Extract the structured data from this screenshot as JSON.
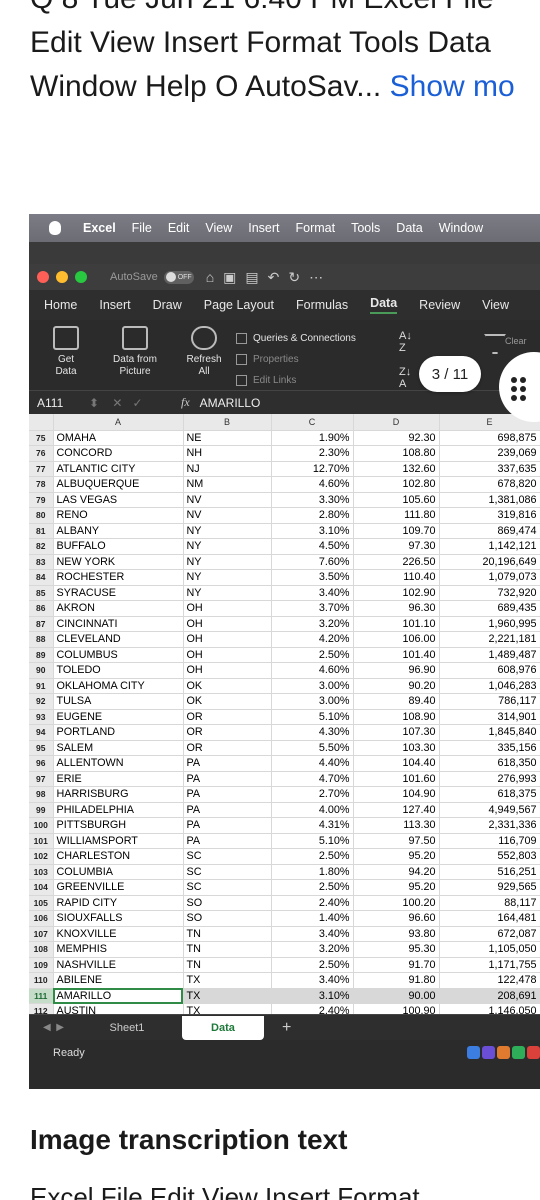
{
  "post": {
    "top_cut_text": "Q 8 Tue Jun 21 6:40 PM Excel File",
    "line1": "Edit View Insert Format Tools Data",
    "line2": "Window Help O AutoSav...",
    "show_more": "Show mo",
    "heading": "Image transcription text",
    "bottom_cut_text": "Excel File Edit View Insert Format"
  },
  "mac_menu": {
    "items": [
      "Excel",
      "File",
      "Edit",
      "View",
      "Insert",
      "Format",
      "Tools",
      "Data",
      "Window"
    ]
  },
  "titlebar": {
    "autosave": "AutoSave",
    "toggle": "OFF"
  },
  "ribbon_tabs": [
    "Home",
    "Insert",
    "Draw",
    "Page Layout",
    "Formulas",
    "Data",
    "Review",
    "View"
  ],
  "ribbon": {
    "get_data": [
      "Get",
      "Data"
    ],
    "data_from_picture": [
      "Data from",
      "Picture"
    ],
    "refresh_all": [
      "Refresh",
      "All"
    ],
    "queries": "Queries & Connections",
    "properties": "Properties",
    "edit_links": "Edit Links",
    "clear": "Clear"
  },
  "pager": {
    "label": "3 / 11"
  },
  "formula_bar": {
    "cell_ref": "A111",
    "fx": "fx",
    "value": "AMARILLO"
  },
  "columns": [
    "A",
    "B",
    "C",
    "D",
    "E"
  ],
  "rows": [
    [
      "75",
      "OMAHA",
      "NE",
      "1.90%",
      "92.30",
      "698,875"
    ],
    [
      "76",
      "CONCORD",
      "NH",
      "2.30%",
      "108.80",
      "239,069"
    ],
    [
      "77",
      "ATLANTIC CITY",
      "NJ",
      "12.70%",
      "132.60",
      "337,635"
    ],
    [
      "78",
      "ALBUQUERQUE",
      "NM",
      "4.60%",
      "102.80",
      "678,820"
    ],
    [
      "79",
      "LAS VEGAS",
      "NV",
      "3.30%",
      "105.60",
      "1,381,086"
    ],
    [
      "80",
      "RENO",
      "NV",
      "2.80%",
      "111.80",
      "319,816"
    ],
    [
      "81",
      "ALBANY",
      "NY",
      "3.10%",
      "109.70",
      "869,474"
    ],
    [
      "82",
      "BUFFALO",
      "NY",
      "4.50%",
      "97.30",
      "1,142,121"
    ],
    [
      "83",
      "NEW YORK",
      "NY",
      "7.60%",
      "226.50",
      "20,196,649"
    ],
    [
      "84",
      "ROCHESTER",
      "NY",
      "3.50%",
      "110.40",
      "1,079,073"
    ],
    [
      "85",
      "SYRACUSE",
      "NY",
      "3.40%",
      "102.90",
      "732,920"
    ],
    [
      "86",
      "AKRON",
      "OH",
      "3.70%",
      "96.30",
      "689,435"
    ],
    [
      "87",
      "CINCINNATI",
      "OH",
      "3.20%",
      "101.10",
      "1,960,995"
    ],
    [
      "88",
      "CLEVELAND",
      "OH",
      "4.20%",
      "106.00",
      "2,221,181"
    ],
    [
      "89",
      "COLUMBUS",
      "OH",
      "2.50%",
      "101.40",
      "1,489,487"
    ],
    [
      "90",
      "TOLEDO",
      "OH",
      "4.60%",
      "96.90",
      "608,976"
    ],
    [
      "91",
      "OKLAHOMA CITY",
      "OK",
      "3.00%",
      "90.20",
      "1,046,283"
    ],
    [
      "92",
      "TULSA",
      "OK",
      "3.00%",
      "89.40",
      "786,117"
    ],
    [
      "93",
      "EUGENE",
      "OR",
      "5.10%",
      "108.90",
      "314,901"
    ],
    [
      "94",
      "PORTLAND",
      "OR",
      "4.30%",
      "107.30",
      "1,845,840"
    ],
    [
      "95",
      "SALEM",
      "OR",
      "5.50%",
      "103.30",
      "335,156"
    ],
    [
      "96",
      "ALLENTOWN",
      "PA",
      "4.40%",
      "104.40",
      "618,350"
    ],
    [
      "97",
      "ERIE",
      "PA",
      "4.70%",
      "101.60",
      "276,993"
    ],
    [
      "98",
      "HARRISBURG",
      "PA",
      "2.70%",
      "104.90",
      "618,375"
    ],
    [
      "99",
      "PHILADELPHIA",
      "PA",
      "4.00%",
      "127.40",
      "4,949,567"
    ],
    [
      "100",
      "PITTSBURGH",
      "PA",
      "4.31%",
      "113.30",
      "2,331,336"
    ],
    [
      "101",
      "WILLIAMSPORT",
      "PA",
      "5.10%",
      "97.50",
      "116,709"
    ],
    [
      "102",
      "CHARLESTON",
      "SC",
      "2.50%",
      "95.20",
      "552,803"
    ],
    [
      "103",
      "COLUMBIA",
      "SC",
      "1.80%",
      "94.20",
      "516,251"
    ],
    [
      "104",
      "GREENVILLE",
      "SC",
      "2.50%",
      "95.20",
      "929,565"
    ],
    [
      "105",
      "RAPID CITY",
      "SO",
      "2.40%",
      "100.20",
      "88,117"
    ],
    [
      "106",
      "SIOUXFALLS",
      "SO",
      "1.40%",
      "96.60",
      "164,481"
    ],
    [
      "107",
      "KNOXVILLE",
      "TN",
      "3.40%",
      "93.80",
      "672,087"
    ],
    [
      "108",
      "MEMPHIS",
      "TN",
      "3.20%",
      "95.30",
      "1,105,050"
    ],
    [
      "109",
      "NASHVILLE",
      "TN",
      "2.50%",
      "91.70",
      "1,171,755"
    ],
    [
      "110",
      "ABILENE",
      "TX",
      "3.40%",
      "91.80",
      "122,478"
    ],
    [
      "111",
      "AMARILLO",
      "TX",
      "3.10%",
      "90.00",
      "208,691"
    ],
    [
      "112",
      "AUSTIN",
      "TX",
      "2.40%",
      "100.90",
      "1,146,050"
    ]
  ],
  "selected_row": "111",
  "sheet_tabs": [
    "Sheet1",
    "Data"
  ],
  "active_sheet": "Data",
  "status": "Ready",
  "colors": {
    "accent_green": "#1e7a3a",
    "link_blue": "#1a5fd6",
    "traffic_red": "#ff5f57",
    "traffic_yellow": "#febc2e",
    "traffic_green": "#28c840"
  }
}
